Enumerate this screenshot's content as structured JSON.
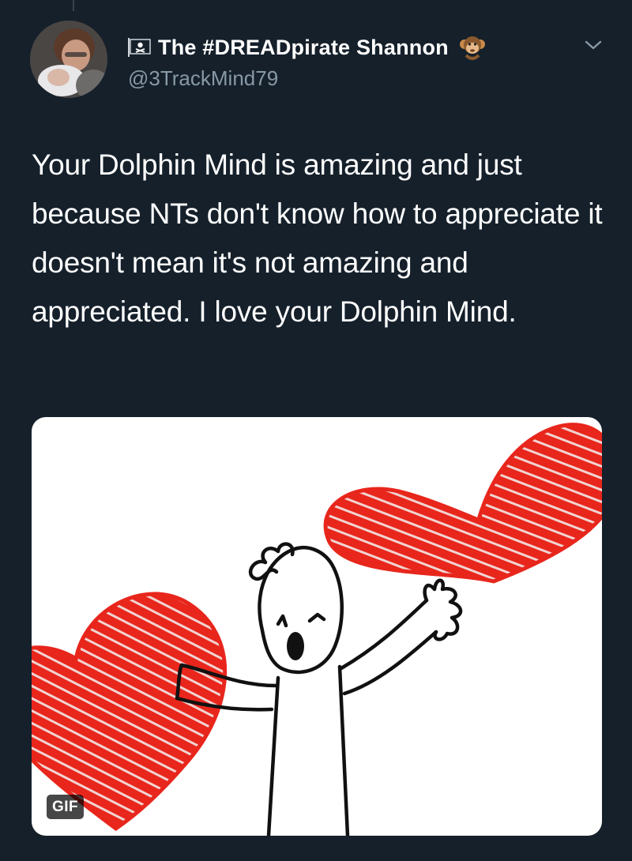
{
  "tweet": {
    "author": {
      "display_name": "The #DREADpirate Shannon",
      "handle": "@3TrackMind79",
      "prefix_icon": "pirate-flag-icon",
      "suffix_icon": "monkey-emoji-icon"
    },
    "menu_icon": "chevron-down-icon",
    "text": "Your Dolphin Mind is amazing and just because NTs don't know how to appreciate it doesn't mean it's not amazing and appreciated. I love your Dolphin Mind.",
    "media": {
      "type": "gif",
      "badge": "GIF"
    }
  },
  "colors": {
    "background": "#15202b",
    "text_primary": "#ffffff",
    "text_secondary": "#8899a6",
    "heart_red": "#e8261c"
  }
}
